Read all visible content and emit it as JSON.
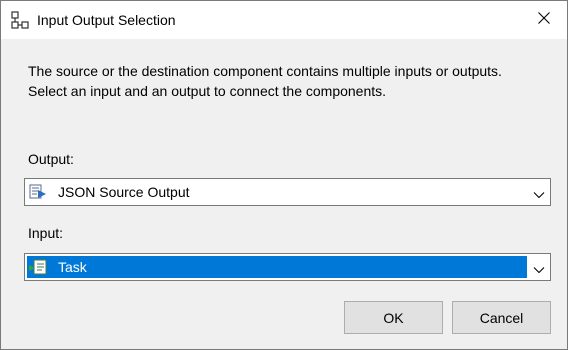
{
  "window": {
    "title": "Input Output Selection",
    "app_icon": "flow-connector-icon",
    "close_icon": "close-icon"
  },
  "description": {
    "line1": "The source or the destination component contains multiple inputs or outputs.",
    "line2": "Select an input and an output to connect the components."
  },
  "output": {
    "label": "Output:",
    "selected_value": "JSON Source Output",
    "icon": "source-output-icon"
  },
  "input": {
    "label": "Input:",
    "selected_value": "Task",
    "icon": "task-input-icon",
    "highlight_color": "#0078d7"
  },
  "buttons": {
    "ok_label": "OK",
    "cancel_label": "Cancel"
  }
}
